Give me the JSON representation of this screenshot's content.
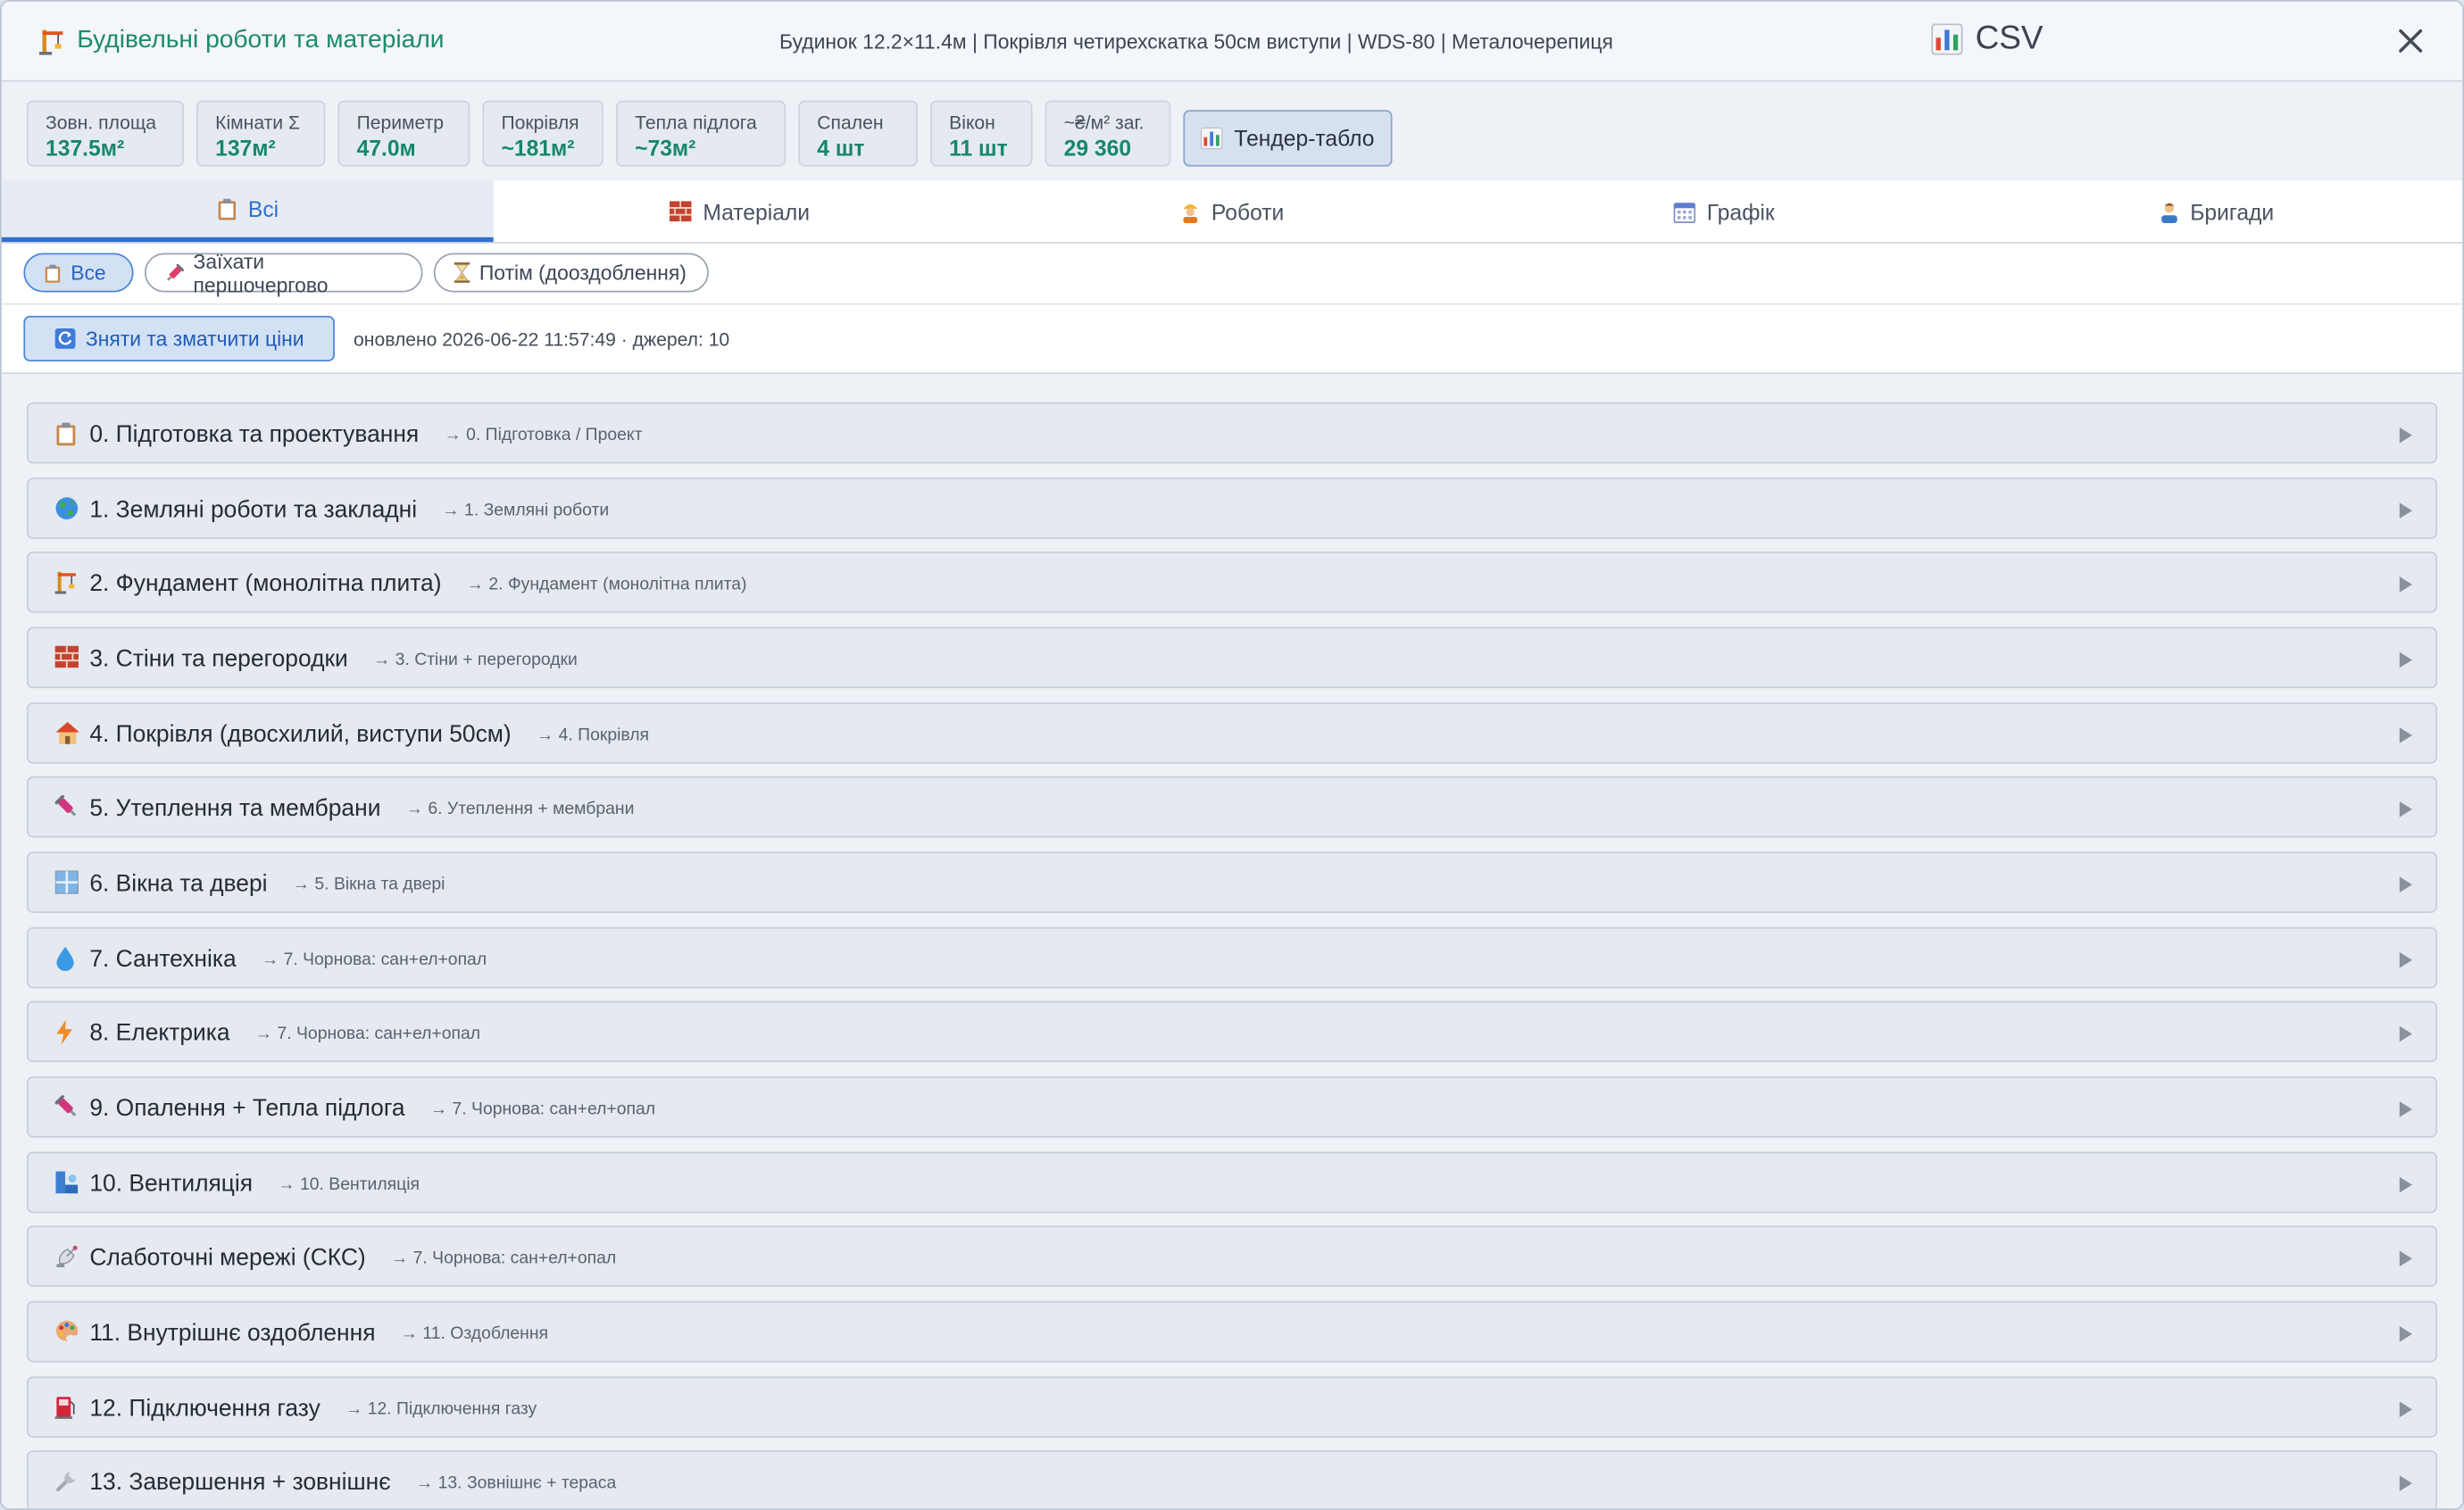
{
  "header": {
    "title": "Будівельні роботи та матеріали",
    "title_icon": "crane-icon",
    "subtitle": "Будинок 12.2×11.4м | Покрівля четирехскатка 50см виступи | WDS-80 | Металочерепиця",
    "csv_label": "CSV",
    "csv_icon": "bar-chart-icon",
    "close_icon": "close-icon"
  },
  "stats": [
    {
      "label": "Зовн. площа",
      "value": "137.5м²"
    },
    {
      "label": "Кімнати Σ",
      "value": "137м²"
    },
    {
      "label": "Периметр",
      "value": "47.0м"
    },
    {
      "label": "Покрівля",
      "value": "~181м²"
    },
    {
      "label": "Тепла підлога",
      "value": "~73м²"
    },
    {
      "label": "Спален",
      "value": "4 шт"
    },
    {
      "label": "Вікон",
      "value": "11 шт"
    },
    {
      "label": "~₴/м² заг.",
      "value": "29 360"
    }
  ],
  "tender_button": {
    "label": "Тендер-табло",
    "icon": "bar-chart-icon"
  },
  "tabs": [
    {
      "label": "Всі",
      "icon": "clipboard-icon",
      "active": true
    },
    {
      "label": "Матеріали",
      "icon": "brick-icon",
      "active": false
    },
    {
      "label": "Роботи",
      "icon": "worker-icon",
      "active": false
    },
    {
      "label": "Графік",
      "icon": "calendar-icon",
      "active": false
    },
    {
      "label": "Бригади",
      "icon": "team-icon",
      "active": false
    }
  ],
  "filters": [
    {
      "label": "Все",
      "icon": "clipboard-icon",
      "active": true
    },
    {
      "label": "Заїхати першочергово",
      "icon": "syringe-icon",
      "active": false
    },
    {
      "label": "Потім (дооздоблення)",
      "icon": "hourglass-icon",
      "active": false
    }
  ],
  "refresh": {
    "button_label": "Зняти та зматчити ціни",
    "button_icon": "refresh-icon",
    "status": "оновлено 2026-06-22 11:57:49 · джерел: 10"
  },
  "sections": [
    {
      "name": "0. Підготовка та проектування",
      "tag": "→ 0. Підготовка / Проект",
      "icon": "clipboard-icon"
    },
    {
      "name": "1. Земляні роботи та закладні",
      "tag": "→ 1. Земляні роботи",
      "icon": "globe-icon"
    },
    {
      "name": "2. Фундамент (монолітна плита)",
      "tag": "→ 2. Фундамент (монолітна плита)",
      "icon": "crane-icon"
    },
    {
      "name": "3. Стіни та перегородки",
      "tag": "→ 3. Стіни + перегородки",
      "icon": "brick-icon"
    },
    {
      "name": "4. Покрівля (двосхилий, виступи 50см)",
      "tag": "→ 4. Покрівля",
      "icon": "house-icon"
    },
    {
      "name": "5. Утеплення та мембрани",
      "tag": "→ 6. Утеплення + мембрани",
      "icon": "syringe-icon"
    },
    {
      "name": "6. Вікна та двері",
      "tag": "→ 5. Вікна та двері",
      "icon": "window-icon"
    },
    {
      "name": "7. Сантехніка",
      "tag": "→ 7. Чорнова: сан+ел+опал",
      "icon": "droplet-icon"
    },
    {
      "name": "8. Електрика",
      "tag": "→ 7. Чорнова: сан+ел+опал",
      "icon": "lightning-icon"
    },
    {
      "name": "9. Опалення + Тепла підлога",
      "tag": "→ 7. Чорнова: сан+ел+опал",
      "icon": "syringe-icon"
    },
    {
      "name": "10. Вентиляція",
      "tag": "→ 10. Вентиляція",
      "icon": "fan-duct-icon"
    },
    {
      "name": "Слаботочні мережі (СКС)",
      "tag": "→ 7. Чорнова: сан+ел+опал",
      "icon": "satellite-icon"
    },
    {
      "name": "11. Внутрішнє оздоблення",
      "tag": "→ 11. Оздоблення",
      "icon": "palette-icon"
    },
    {
      "name": "12. Підключення газу",
      "tag": "→ 12. Підключення газу",
      "icon": "fuel-pump-icon"
    },
    {
      "name": "13. Завершення + зовнішнє",
      "tag": "→ 13. Зовнішнє + тераса",
      "icon": "wrench-icon"
    }
  ],
  "colors": {
    "accent_green": "#17876a",
    "accent_blue": "#2f6fd0",
    "section_bg": "#e5e9f0"
  }
}
